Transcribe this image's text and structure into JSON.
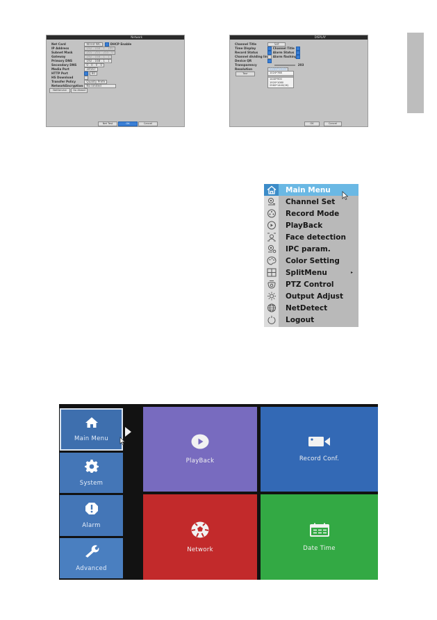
{
  "network_dialog": {
    "title": "Network",
    "rows": [
      {
        "label": "Net Card",
        "value": "Wired NIC",
        "extra_label": "DHCP Enable",
        "extra_checked": true
      },
      {
        "label": "IP Address",
        "value": "192 . 168 . 1 . 100",
        "dim": true
      },
      {
        "label": "Subnet Mask",
        "value": "255 . 255 . 255 . 0",
        "dim": true
      },
      {
        "label": "Gateway",
        "value": "192 . 168 . 1 . 1",
        "dim": true
      },
      {
        "label": "Primary DNS",
        "value": "192 . 168 . 1 . 1"
      },
      {
        "label": "Secondary DNS",
        "value": "0 . 0 . 0 . 0"
      },
      {
        "label": "Media Port",
        "value": "34567"
      },
      {
        "label": "HTTP Port",
        "value": "80",
        "checked": true
      },
      {
        "label": "HS Download",
        "checked": false
      },
      {
        "label": "Transfer Policy",
        "value": "Quality Prefe"
      },
      {
        "label": "NetworkEncryption",
        "value": "No limited"
      }
    ],
    "net_service_button": "NetService",
    "go_ahead_button": "Go Ahead",
    "buttons": {
      "net_test": "Net Test",
      "ok": "OK",
      "cancel": "Cancel"
    }
  },
  "display_dialog": {
    "title": "DISPLAY",
    "channel_title_label": "Channel Title",
    "channel_title_button": "Set",
    "time_display_label": "Time Display",
    "time_display_checked": true,
    "channel_title_chk_label": "Channel Title",
    "channel_title_checked": true,
    "record_status_label": "Record Status",
    "record_status_checked": true,
    "alarm_status_label": "Alarm Status",
    "alarm_status_checked": true,
    "channel_dividing_label": "Channel dividing line",
    "channel_dividing_checked": false,
    "alarm_flashing_label": "Alarm flashing",
    "alarm_flashing_checked": true,
    "device_qr_label": "Device QR",
    "device_qr_checked": true,
    "transparency_label": "Transparency",
    "transparency_value": "203",
    "resolution_label": "Resolution",
    "resolution_selected": "1280*1024",
    "resolution_options": [
      "1024*768",
      "1280*1024",
      "1440*900",
      "1920*1080",
      "2560*1440(2K)"
    ],
    "tour_button": "Tour",
    "buttons": {
      "ok": "OK",
      "cancel": "Cancel"
    }
  },
  "context_menu": {
    "items": [
      {
        "label": "Main Menu",
        "icon": "home-icon",
        "active": true
      },
      {
        "label": "Channel Set",
        "icon": "camera-channel-icon"
      },
      {
        "label": "Record Mode",
        "icon": "record-reel-icon"
      },
      {
        "label": "PlayBack",
        "icon": "play-circle-icon"
      },
      {
        "label": "Face detection",
        "icon": "face-detection-icon"
      },
      {
        "label": "IPC param.",
        "icon": "ipc-camera-icon"
      },
      {
        "label": "Color Setting",
        "icon": "palette-icon"
      },
      {
        "label": "SplitMenu",
        "icon": "grid-split-icon",
        "submenu": "▸"
      },
      {
        "label": "PTZ Control",
        "icon": "ptz-camera-icon"
      },
      {
        "label": "Output Adjust",
        "icon": "brightness-icon"
      },
      {
        "label": "NetDetect",
        "icon": "globe-icon"
      },
      {
        "label": "Logout",
        "icon": "power-icon"
      }
    ]
  },
  "main_menu": {
    "sidebar": [
      {
        "label": "Main Menu",
        "icon": "home-icon",
        "active": true
      },
      {
        "label": "System",
        "icon": "gear-icon"
      },
      {
        "label": "Alarm",
        "icon": "alarm-alert-icon"
      },
      {
        "label": "Advanced",
        "icon": "wrench-icon"
      }
    ],
    "tiles": [
      {
        "label": "PlayBack",
        "icon": "play-circle-icon",
        "color": "#786bbf"
      },
      {
        "label": "Record Conf.",
        "icon": "video-camera-icon",
        "color": "#3369b5"
      },
      {
        "label": "Network",
        "icon": "network-ball-icon",
        "color": "#c22a2b"
      },
      {
        "label": "Date Time",
        "icon": "calendar-icon",
        "color": "#33a944"
      }
    ]
  }
}
